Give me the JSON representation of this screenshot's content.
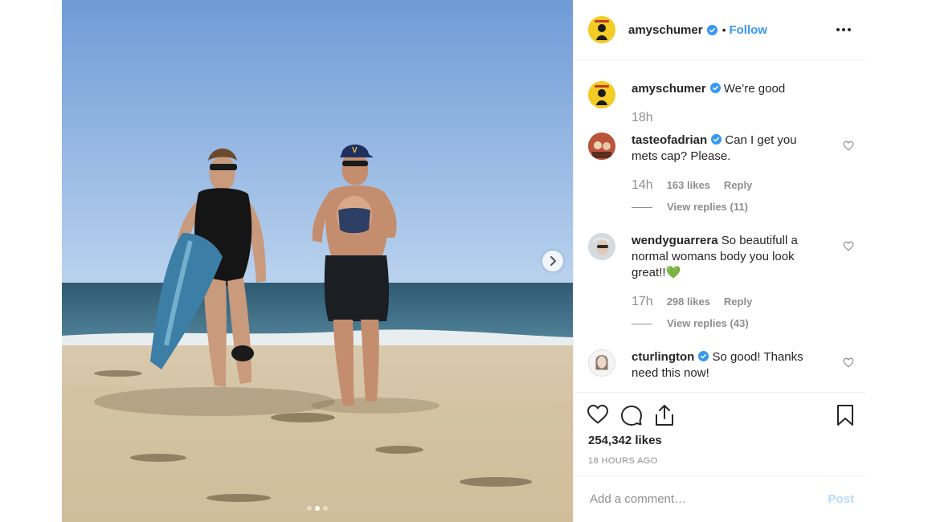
{
  "post": {
    "author": "amyschumer",
    "follow_label": "Follow",
    "bullet": "•",
    "caption": {
      "username": "amyschumer",
      "text": "We’re good",
      "time": "18h"
    },
    "photo": {
      "pages": 3,
      "active_page": 2
    }
  },
  "comments": [
    {
      "username": "tasteofadrian",
      "text": "Can I get you mets cap? Please.",
      "time": "14h",
      "likes": "163 likes",
      "reply": "Reply",
      "view_replies": "View replies (11)",
      "verified": true
    },
    {
      "username": "wendyguarrera",
      "text": "So beautifull a normal womans body you look great!!💚",
      "time": "17h",
      "likes": "298 likes",
      "reply": "Reply",
      "view_replies": "View replies (43)",
      "verified": false
    },
    {
      "username": "cturlington",
      "text": "So good! Thanks need this now!",
      "verified": true
    }
  ],
  "actions": {
    "likes": "254,342 likes",
    "time_ago": "18 HOURS AGO"
  },
  "add_comment": {
    "placeholder": "Add a comment…",
    "post_label": "Post"
  },
  "colors": {
    "link": "#3897f0",
    "verified": "#3897f0",
    "post_disabled": "#b3dbff",
    "muted": "#8e8e8e"
  }
}
